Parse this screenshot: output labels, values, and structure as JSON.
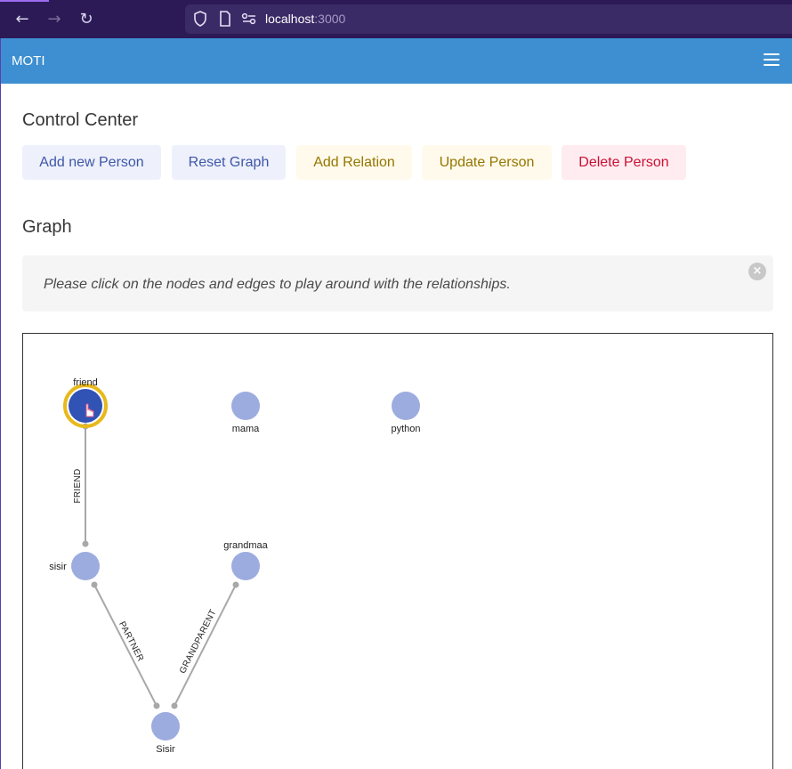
{
  "browser": {
    "url_host": "localhost",
    "url_port": ":3000"
  },
  "app": {
    "brand": "MOTI"
  },
  "control_center": {
    "title": "Control Center",
    "buttons": {
      "add_person": "Add new Person",
      "reset_graph": "Reset Graph",
      "add_relation": "Add Relation",
      "update_person": "Update Person",
      "delete_person": "Delete Person"
    }
  },
  "graph_section": {
    "title": "Graph",
    "notification": "Please click on the nodes and edges to play around with the relationships.",
    "close_symbol": "×"
  },
  "graph": {
    "nodes": {
      "friend": "friend",
      "mama": "mama",
      "python": "python",
      "sisir_lower": "sisir",
      "grandmaa": "grandmaa",
      "sisir_upper": "Sisir"
    },
    "edges": {
      "friend": "FRIEND",
      "partner": "PARTNER",
      "grandparent": "GRANDPARENT"
    },
    "selected_node": "friend"
  },
  "colors": {
    "navbar": "#3d8fd1",
    "node_fill": "#9dacdf",
    "node_selected_fill": "#3153b5",
    "node_selected_ring": "#e8b91c",
    "edge": "#a8a8a8"
  }
}
